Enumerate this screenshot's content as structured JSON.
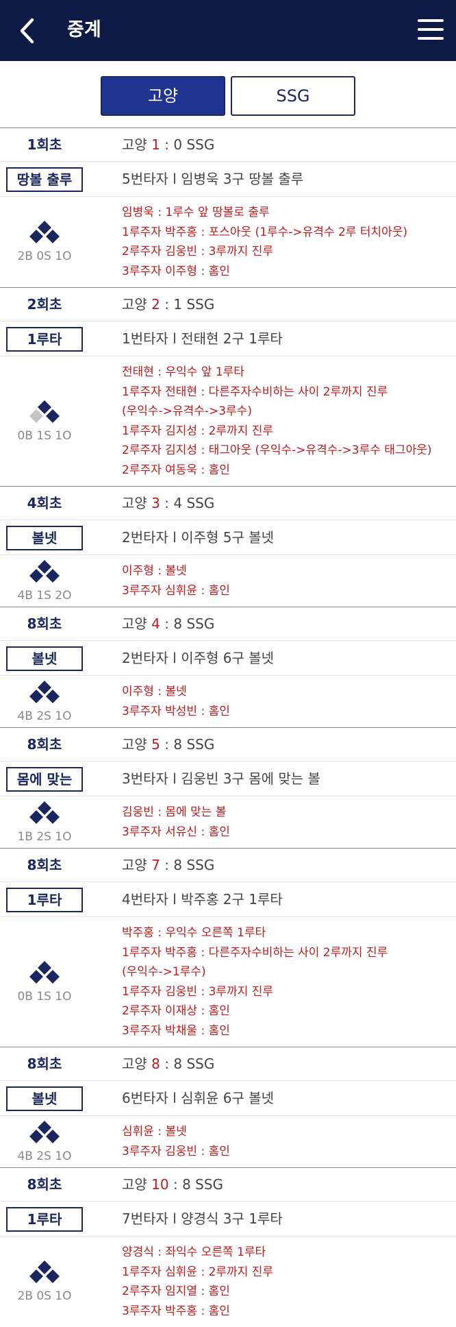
{
  "header": {
    "title": "중계",
    "back_icon": "back-chevron-icon",
    "menu_icon": "hamburger-menu-icon"
  },
  "tabs": [
    {
      "label": "고양",
      "selected": true
    },
    {
      "label": "SSG",
      "selected": false
    }
  ],
  "colors": {
    "navy": "#0d1a45",
    "tab_active": "#1f3390",
    "accent_red": "#c21a1a",
    "base_filled": "#1b2660",
    "base_empty": "#c4c4c4"
  },
  "plays": [
    {
      "inning": "1회초",
      "team_home": "고양",
      "score_home": "1",
      "sep": " : ",
      "score_away_text": "0 SSG",
      "badge": "땅볼 출루",
      "batter": "5번타자 l 임병욱 3구 땅볼 출루",
      "count": "2B 0S 1O",
      "bases": {
        "first": true,
        "second": true,
        "third": true
      },
      "events": [
        "임병욱 : 1루수 앞 땅볼로 출루",
        "1루주자 박주홍 : 포스아웃 (1루수->유격수 2루 터치아웃)",
        "2루주자 김웅빈 : 3루까지 진루",
        "3루주자 이주형 : 홈인"
      ]
    },
    {
      "inning": "2회초",
      "team_home": "고양",
      "score_home": "2",
      "sep": " : ",
      "score_away_text": "1 SSG",
      "badge": "1루타",
      "batter": "1번타자 l 전태현 2구 1루타",
      "count": "0B 1S 1O",
      "bases": {
        "first": true,
        "second": true,
        "third": false
      },
      "events": [
        "전태현 : 우익수 앞 1루타",
        "1루주자 전태현 : 다른주자수비하는 사이 2루까지 진루",
        "(우익수->유격수->3루수)",
        "1루주자 김지성 : 2루까지 진루",
        "2루주자 김지성 : 태그아웃 (우익수->유격수->3루수 태그아웃)",
        "2루주자 여동욱 : 홈인"
      ]
    },
    {
      "inning": "4회초",
      "team_home": "고양",
      "score_home": "3",
      "sep": " : ",
      "score_away_text": "4 SSG",
      "badge": "볼넷",
      "batter": "2번타자 l 이주형 5구 볼넷",
      "count": "4B 1S 2O",
      "bases": {
        "first": true,
        "second": true,
        "third": true
      },
      "events": [
        "이주형 : 볼넷",
        "3루주자 심휘윤 : 홈인"
      ]
    },
    {
      "inning": "8회초",
      "team_home": "고양",
      "score_home": "4",
      "sep": " : ",
      "score_away_text": "8 SSG",
      "badge": "볼넷",
      "batter": "2번타자 l 이주형 6구 볼넷",
      "count": "4B 2S 1O",
      "bases": {
        "first": true,
        "second": true,
        "third": true
      },
      "events": [
        "이주형 : 볼넷",
        "3루주자 박성빈 : 홈인"
      ]
    },
    {
      "inning": "8회초",
      "team_home": "고양",
      "score_home": "5",
      "sep": " : ",
      "score_away_text": "8 SSG",
      "badge": "몸에 맞는",
      "batter": "3번타자 l 김웅빈 3구 몸에 맞는 볼",
      "count": "1B 2S 1O",
      "bases": {
        "first": true,
        "second": true,
        "third": true
      },
      "events": [
        "김웅빈 : 몸에 맞는 볼",
        "3루주자 서유신 : 홈인"
      ]
    },
    {
      "inning": "8회초",
      "team_home": "고양",
      "score_home": "7",
      "sep": " : ",
      "score_away_text": "8 SSG",
      "badge": "1루타",
      "batter": "4번타자 l 박주홍 2구 1루타",
      "count": "0B 1S 1O",
      "bases": {
        "first": true,
        "second": true,
        "third": true
      },
      "events": [
        "박주홍 : 우익수 오른쪽 1루타",
        "1루주자 박주홍 : 다른주자수비하는 사이 2루까지 진루",
        "(우익수->1루수)",
        "1루주자 김웅빈 : 3루까지 진루",
        "2루주자 이재상 : 홈인",
        "3루주자 박채울 : 홈인"
      ]
    },
    {
      "inning": "8회초",
      "team_home": "고양",
      "score_home": "8",
      "sep": " : ",
      "score_away_text": "8 SSG",
      "badge": "볼넷",
      "batter": "6번타자 l 심휘윤 6구 볼넷",
      "count": "4B 2S 1O",
      "bases": {
        "first": true,
        "second": true,
        "third": true
      },
      "events": [
        "심휘윤 : 볼넷",
        "3루주자 김웅빈 : 홈인"
      ]
    },
    {
      "inning": "8회초",
      "team_home": "고양",
      "score_home": "10",
      "sep": " : ",
      "score_away_text": "8 SSG",
      "badge": "1루타",
      "batter": "7번타자 l 양경식 3구 1루타",
      "count": "2B 0S 1O",
      "bases": {
        "first": true,
        "second": true,
        "third": true
      },
      "events": [
        "양경식 : 좌익수 오른쪽 1루타",
        "1루주자 심휘윤 : 2루까지 진루",
        "2루주자 임지열 : 홈인",
        "3루주자 박주홍 : 홈인"
      ]
    }
  ]
}
